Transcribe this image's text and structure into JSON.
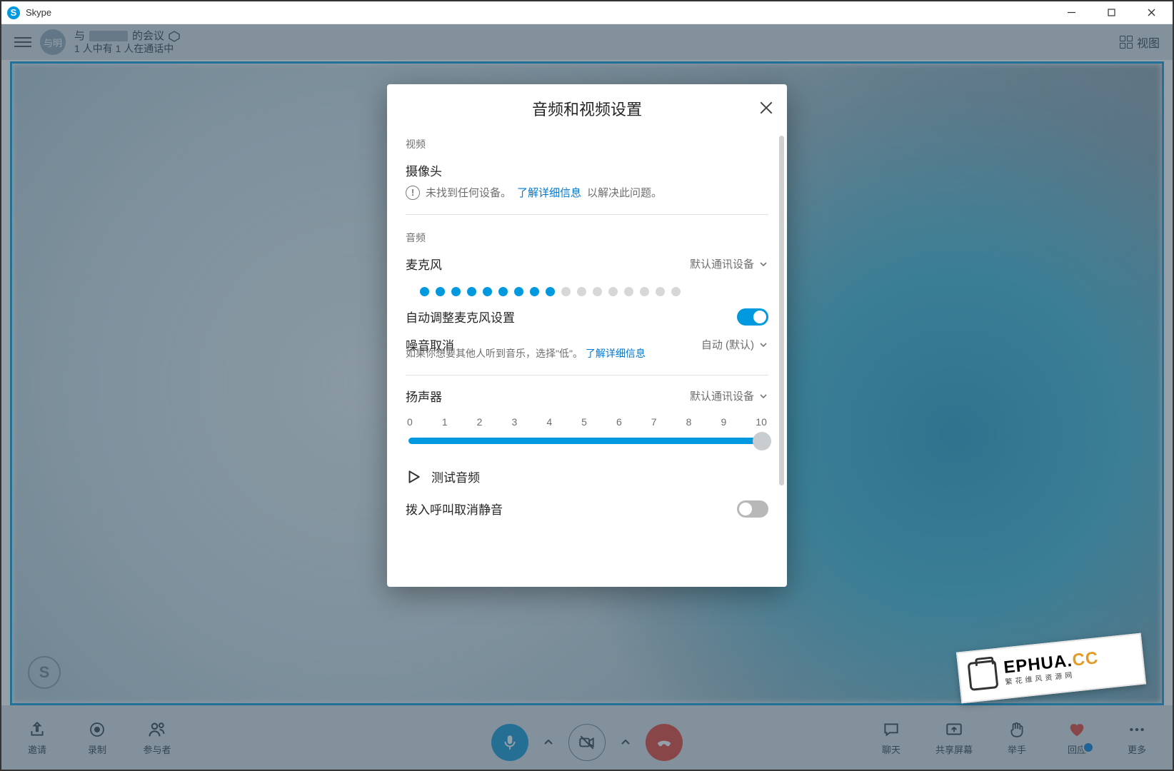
{
  "app": {
    "name": "Skype"
  },
  "header": {
    "avatar_text": "与明",
    "meeting_title_prefix": "与",
    "meeting_title_suffix": "的会议",
    "subtitle": "1 人中有 1 人在通话中",
    "view_label": "视图"
  },
  "toolbar": {
    "invite": "邀请",
    "record": "录制",
    "participants": "参与者",
    "chat": "聊天",
    "share_screen": "共享屏幕",
    "raise_hand": "举手",
    "reactions": "回应",
    "more": "更多"
  },
  "dialog": {
    "title": "音频和视频设置",
    "video_section": "视频",
    "camera_label": "摄像头",
    "no_device_text": "未找到任何设备。",
    "learn_more": "了解详细信息",
    "resolve_suffix": "以解决此问题。",
    "audio_section": "音频",
    "mic_label": "麦克风",
    "default_device": "默认通讯设备",
    "mic_level_active": 9,
    "mic_level_total": 17,
    "auto_mic_label": "自动调整麦克风设置",
    "auto_mic_on": true,
    "noise_cancel_label": "噪音取消",
    "noise_cancel_value": "自动 (默认)",
    "noise_desc_prefix": "如果你想要其他人听到音乐，选择\"低\"。",
    "speaker_label": "扬声器",
    "speaker_device": "默认通讯设备",
    "slider_ticks": [
      "0",
      "1",
      "2",
      "3",
      "4",
      "5",
      "6",
      "7",
      "8",
      "9",
      "10"
    ],
    "slider_value": 10,
    "test_audio": "测试音频",
    "unmute_incoming": "拨入呼叫取消静音",
    "unmute_on": false
  },
  "watermark": {
    "main_a": "EPHUA.",
    "main_b": "CC",
    "sub": "繁花维风资源网"
  }
}
